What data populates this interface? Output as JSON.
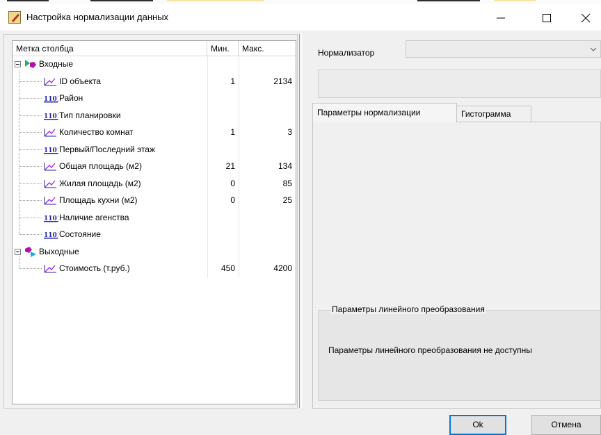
{
  "window": {
    "title": "Настройка нормализации данных"
  },
  "tree": {
    "columns": {
      "label": "Метка столбца",
      "min": "Мин.",
      "max": "Макс."
    },
    "groups": [
      {
        "label": "Входные",
        "items": [
          {
            "label": "ID объекта",
            "icon": "linear-icon",
            "min": "1",
            "max": "2134"
          },
          {
            "label": "Район",
            "icon": "binary-icon",
            "min": "",
            "max": ""
          },
          {
            "label": "Тип планировки",
            "icon": "binary-icon",
            "min": "",
            "max": ""
          },
          {
            "label": "Количество комнат",
            "icon": "linear-icon",
            "min": "1",
            "max": "3"
          },
          {
            "label": "Первый/Последний этаж",
            "icon": "binary-icon",
            "min": "",
            "max": ""
          },
          {
            "label": "Общая площадь (м2)",
            "icon": "linear-icon",
            "min": "21",
            "max": "134"
          },
          {
            "label": "Жилая площадь (м2)",
            "icon": "linear-icon",
            "min": "0",
            "max": "85"
          },
          {
            "label": "Площадь кухни (м2)",
            "icon": "linear-icon",
            "min": "0",
            "max": "25"
          },
          {
            "label": "Наличие агенства",
            "icon": "binary-icon",
            "min": "",
            "max": ""
          },
          {
            "label": "Состояние",
            "icon": "binary-icon",
            "min": "",
            "max": ""
          }
        ]
      },
      {
        "label": "Выходные",
        "items": [
          {
            "label": "Стоимость (т.руб.)",
            "icon": "linear-icon",
            "min": "450",
            "max": "4200"
          }
        ]
      }
    ],
    "binary_icon_text": "1101"
  },
  "normalizer": {
    "label": "Нормализатор",
    "value": ""
  },
  "tabs": [
    "Параметры нормализации",
    "Гистограмма"
  ],
  "linear_group": {
    "title": "Параметры линейного преобразования",
    "message": "Параметры линейного преобразования не доступны"
  },
  "buttons": {
    "ok": "Ok",
    "cancel": "Отмена"
  },
  "colors": {
    "accent": "#0078d7",
    "linear_icon": "#a020f0",
    "binary_icon": "#1f1fa8"
  }
}
